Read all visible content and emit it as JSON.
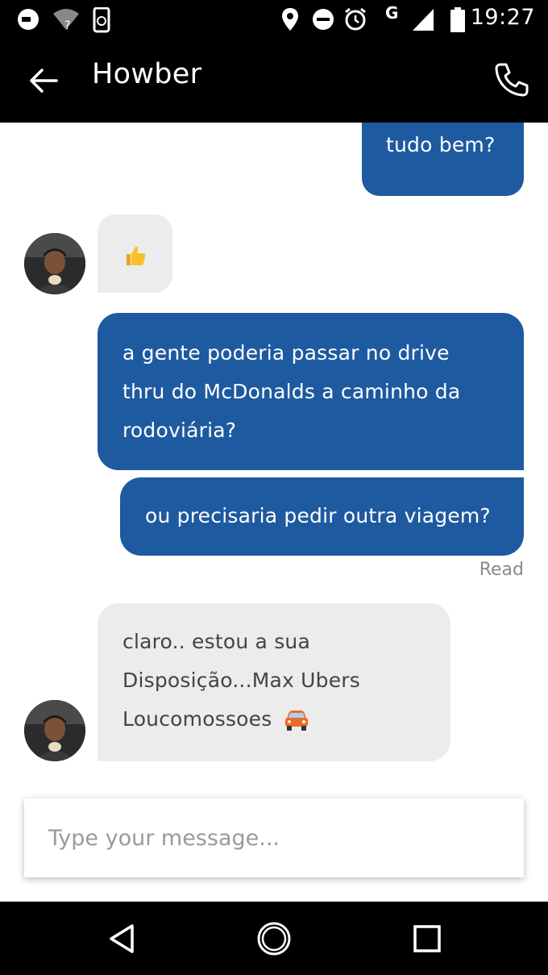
{
  "status_bar": {
    "time": "19:27",
    "network_label": "G",
    "icons": [
      "uber-notification-icon",
      "wifi-question-icon",
      "phone-sync-icon",
      "location-icon",
      "do-not-disturb-icon",
      "alarm-icon",
      "cell-signal-icon",
      "battery-icon"
    ]
  },
  "header": {
    "title": "Howber",
    "back_icon": "back-arrow-icon",
    "call_icon": "phone-icon"
  },
  "messages": [
    {
      "direction": "outgoing",
      "text": "tudo bem?"
    },
    {
      "direction": "incoming",
      "text": "",
      "emoji": "thumbs-up-emoji"
    },
    {
      "direction": "outgoing",
      "lines": [
        "a gente poderia passar no drive",
        "thru do McDonalds a caminho da",
        "rodoviária?"
      ]
    },
    {
      "direction": "outgoing",
      "text": "ou precisaria pedir outra viagem?"
    },
    {
      "direction": "incoming",
      "lines": [
        "claro.. estou a sua",
        "Disposição...Max Ubers",
        "Loucomossoes"
      ],
      "emoji": "car-emoji"
    }
  ],
  "read_status": "Read",
  "composer": {
    "placeholder": "Type your message..."
  },
  "nav_bar": {
    "icons": [
      "nav-back-icon",
      "nav-home-icon",
      "nav-recents-icon"
    ]
  },
  "colors": {
    "outgoing_bubble": "#1e5aa0",
    "incoming_bubble": "#ececec",
    "bars": "#000000"
  }
}
